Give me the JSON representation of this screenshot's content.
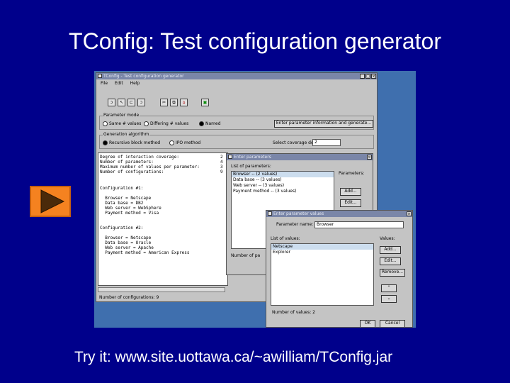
{
  "slide": {
    "title": "TConfig:  Test configuration generator",
    "footer": "Try it:  www.site.uottawa.ca/~awilliam/TConfig.jar"
  },
  "main_window": {
    "title": "TConfig - Test configuration generator",
    "menu": [
      "File",
      "Edit",
      "Help"
    ],
    "param_mode_label": "Parameter mode",
    "param_modes": [
      "Same # values",
      "Differing # values",
      "Named"
    ],
    "enter_info_button": "Enter parameter information and generate...",
    "gen_algo_label": "Generation algorithm",
    "algorithms": [
      "Recursive block method",
      "IPO method"
    ],
    "coverage_label": "Select coverage degree:",
    "coverage_value": "2",
    "output_header": "Degree of interaction coverage:\nNumber of parameters:\nMaximum number of values per parameter:\nNumber of configurations:",
    "output_header_values": "2\n4\n3\n9",
    "output_body": "Configuration #1:\n\n  Browser = Netscape\n  Data base = DB2\n  Web server = WebSphere\n  Payment method = Visa\n\n\nConfiguration #2:\n\n  Browser = Netscape\n  Data base = Oracle\n  Web server = Apache\n  Payment method = American Express",
    "status": "Number of configurations: 9"
  },
  "params_dialog": {
    "title": "Enter parameters",
    "list_label": "List of parameters:",
    "items": [
      "Browser -- (2 values)",
      "Data base -- (3 values)",
      "Web server -- (3 values)",
      "Payment method -- (3 values)"
    ],
    "side_label": "Parameters:",
    "add_button": "Add...",
    "edit_button": "Edit...",
    "count_label": "Number of pa"
  },
  "values_dialog": {
    "title": "Enter parameter values",
    "name_label": "Parameter name:",
    "name_value": "Browser",
    "list_label": "List of values:",
    "items": [
      "Netscape",
      "Explorer"
    ],
    "side_label": "Values:",
    "add_button": "Add...",
    "edit_button": "Edit...",
    "remove_button": "Remove...",
    "count_label": "Number of values: 2",
    "ok_button": "OK",
    "cancel_button": "Cancel"
  }
}
